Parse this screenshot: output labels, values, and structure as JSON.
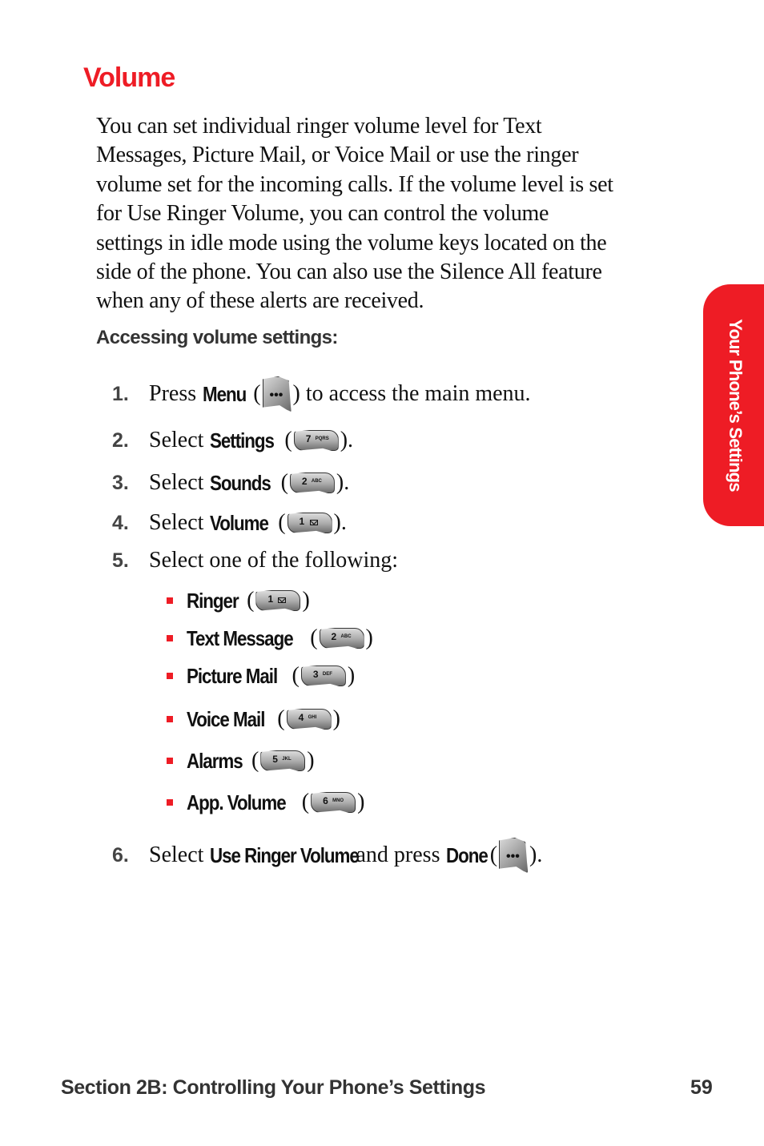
{
  "page": {
    "title": "Volume",
    "intro_lines": [
      "You can set individual ringer volume level for Text",
      "Messages, Picture Mail, or Voice Mail or use the ringer",
      "volume set for the incoming calls. If the volume level is set",
      "for Use Ringer Volume, you can control the volume",
      "settings in idle mode using the volume keys located on the",
      "side of the phone. You can also use the Silence All feature",
      "when any of these alerts are received."
    ],
    "subheading": "Accessing volume settings:",
    "steps": [
      {
        "num": "1.",
        "pre": "Press",
        "keyword": "Menu",
        "open": "(",
        "icon": "softkey-menu-icon",
        "close": ")",
        "post": " to access the main menu."
      },
      {
        "num": "2.",
        "pre": "Select",
        "keyword": "Settings",
        "open": "(",
        "key_num": "7",
        "key_letters": "PQRS",
        "close": ")."
      },
      {
        "num": "3.",
        "pre": "Select",
        "keyword": "Sounds",
        "open": "(",
        "key_num": "2",
        "key_letters": "ABC",
        "close": ")."
      },
      {
        "num": "4.",
        "pre": "Select",
        "keyword": "Volume",
        "open": "(",
        "key_num": "1",
        "key_letters": "envelope",
        "close": ")."
      },
      {
        "num": "5.",
        "text": "Select one of the following:"
      },
      {
        "num": "6.",
        "pre": "Select",
        "keyword": "Use Ringer Volume",
        "mid": "and press",
        "keyword2": "Done",
        "open": "(",
        "icon": "softkey-done-icon",
        "close": ")."
      }
    ],
    "options": [
      {
        "label": "Ringer",
        "key_num": "1",
        "key_letters": "envelope"
      },
      {
        "label": "Text Message",
        "key_num": "2",
        "key_letters": "ABC"
      },
      {
        "label": "Picture Mail",
        "key_num": "3",
        "key_letters": "DEF"
      },
      {
        "label": "Voice Mail",
        "key_num": "4",
        "key_letters": "GHI"
      },
      {
        "label": "Alarms",
        "key_num": "5",
        "key_letters": "JKL"
      },
      {
        "label": "App. Volume",
        "key_num": "6",
        "key_letters": "MNO"
      }
    ],
    "side_tab": "Your Phone’s Settings",
    "footer": {
      "section": "Section 2B: Controlling Your Phone’s Settings",
      "page_number": "59"
    },
    "colors": {
      "accent": "#ee1c25",
      "heading_gray": "#333333"
    }
  }
}
